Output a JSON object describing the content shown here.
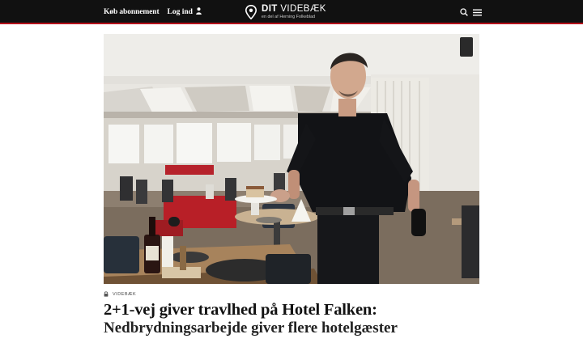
{
  "header": {
    "subscribe_label": "Køb abonnement",
    "login_label": "Log ind",
    "brand_name_bold": "DIT",
    "brand_name_rest": " VIDEBÆK",
    "brand_tagline": "en del af Herning Folkeblad",
    "icons": [
      "user-icon",
      "location-pin-icon",
      "search-icon",
      "menu-icon"
    ]
  },
  "article": {
    "kicker": "VIDEBÆK",
    "headline": "2+1-vej giver travlhed på Hotel Falken:",
    "subheadline": "Nedbrydningsarbejde giver flere hotelgæster"
  },
  "colors": {
    "topbar": "#111111",
    "accent": "#b5121b"
  }
}
